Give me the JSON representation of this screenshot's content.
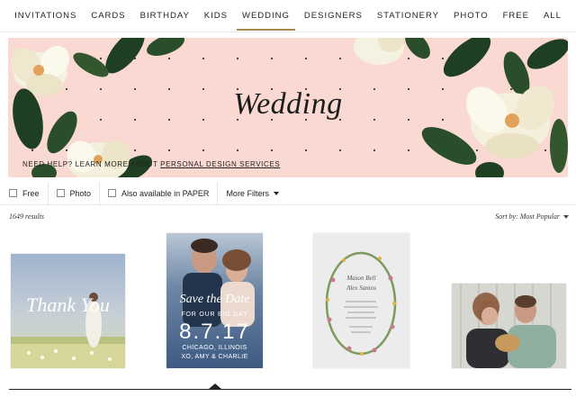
{
  "nav": {
    "items": [
      {
        "label": "INVITATIONS",
        "name": "nav-invitations"
      },
      {
        "label": "CARDS",
        "name": "nav-cards"
      },
      {
        "label": "BIRTHDAY",
        "name": "nav-birthday"
      },
      {
        "label": "KIDS",
        "name": "nav-kids"
      },
      {
        "label": "WEDDING",
        "name": "nav-wedding"
      },
      {
        "label": "DESIGNERS",
        "name": "nav-designers"
      },
      {
        "label": "STATIONERY",
        "name": "nav-stationery"
      },
      {
        "label": "PHOTO",
        "name": "nav-photo"
      },
      {
        "label": "FREE",
        "name": "nav-free"
      },
      {
        "label": "ALL",
        "name": "nav-all"
      }
    ],
    "active": "WEDDING",
    "accent_color": "#a48a4e"
  },
  "banner": {
    "title": "Wedding",
    "help_prefix": "NEED HELP? LEARN MORE ABOUT",
    "help_link": "PERSONAL DESIGN SERVICES",
    "background_color": "#f9d9d2"
  },
  "filters": {
    "free": "Free",
    "photo": "Photo",
    "paper": "Also available in PAPER",
    "more": "More Filters"
  },
  "results": {
    "count": "1649 results",
    "sort": "Sort by: Most Popular"
  },
  "cards": {
    "card1": {
      "script": "Thank You"
    },
    "card2": {
      "script": "Save the Date",
      "line1": "FOR OUR BIG DAY",
      "date": "8.7.17",
      "line2": "CHICAGO, ILLINOIS",
      "line3": "XO, AMY & CHARLIE"
    },
    "card3": {
      "names_a": "Mason Bell",
      "names_b": "Alex Santos"
    },
    "card4": {}
  }
}
